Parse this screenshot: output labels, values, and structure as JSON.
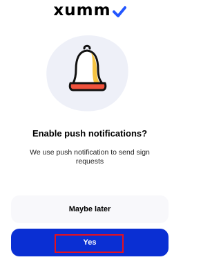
{
  "app": {
    "logo_text": "xumm"
  },
  "onboarding": {
    "heading": "Enable push notifications?",
    "description": "We use push notification to send sign requests"
  },
  "buttons": {
    "maybe_later_label": "Maybe later",
    "yes_label": "Yes"
  },
  "icons": {
    "logo_check": "check-icon",
    "illustration": "bell-icon"
  },
  "colors": {
    "primary": "#0a2fd3",
    "secondary_button_bg": "#f8f8fb",
    "logo_check": "#2356ff",
    "bell_body": "#ffffff",
    "bell_shading": "#f5c342",
    "bell_rim": "#f0523c",
    "blob": "#eef0f8",
    "highlight_box": "#e8101c"
  }
}
